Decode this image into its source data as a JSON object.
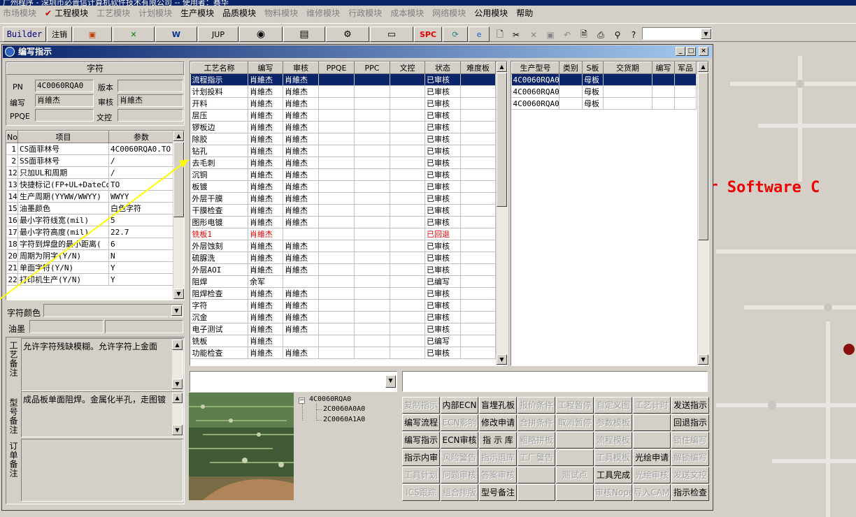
{
  "title_bar": "广州程序 - 深圳市必普信计算机软件技术有限公司 -- 使用者：赛华",
  "menu": [
    {
      "label": "市场模块",
      "enabled": false
    },
    {
      "label": "工程模块",
      "enabled": true,
      "checked": true
    },
    {
      "label": "工艺模块",
      "enabled": false
    },
    {
      "label": "计划模块",
      "enabled": false
    },
    {
      "label": "生产模块",
      "enabled": true
    },
    {
      "label": "品质模块",
      "enabled": true
    },
    {
      "label": "物料模块",
      "enabled": false
    },
    {
      "label": "维修模块",
      "enabled": false
    },
    {
      "label": "行政模块",
      "enabled": false
    },
    {
      "label": "成本模块",
      "enabled": false
    },
    {
      "label": "网络模块",
      "enabled": false
    },
    {
      "label": "公用模块",
      "enabled": true
    },
    {
      "label": "帮助",
      "enabled": true
    }
  ],
  "menu_check": "✔",
  "toolbar": {
    "builder": "Builder",
    "logout": "注销",
    "jup": "JUP",
    "spc": "SPC"
  },
  "background_text": "er Software C",
  "window": {
    "title": "编写指示",
    "min": "_",
    "max": "□",
    "close": "×"
  },
  "char_panel": {
    "header": "字符",
    "pn_label": "PN",
    "pn_value": "4C0060RQA0",
    "version_label": "版本",
    "version_value": "",
    "writer_label": "编写",
    "writer_value": "肖維杰",
    "reviewer_label": "审核",
    "reviewer_value": "肖維杰",
    "ppqe_label": "PPQE",
    "ppqe_value": "",
    "doc_label": "文控",
    "doc_value": ""
  },
  "param_table": {
    "columns": [
      "No",
      "项目",
      "参数"
    ],
    "rows": [
      [
        "1",
        "CS面菲林号",
        "4C0060RQA0.TO"
      ],
      [
        "2",
        "SS面菲林号",
        "/"
      ],
      [
        "12",
        "只加UL和周期",
        "/"
      ],
      [
        "13",
        "快捷标记(FP+UL+DateCo",
        "TO"
      ],
      [
        "14",
        "生产周期(YYWW/WWYY)",
        "WWYY"
      ],
      [
        "15",
        "油墨颜色",
        "白色字符"
      ],
      [
        "16",
        "最小字符线宽(mil)",
        "5"
      ],
      [
        "17",
        "最小字符高度(mil)",
        "22.7"
      ],
      [
        "18",
        "字符到焊盘的最小距离(",
        "6"
      ],
      [
        "20",
        "周期为阴字(Y/N)",
        "N"
      ],
      [
        "21",
        "单面字符(Y/N)",
        "Y"
      ],
      [
        "22",
        "打印机生产(Y/N)",
        "Y"
      ]
    ]
  },
  "char_color_label": "字符颜色",
  "ink_label": "油墨",
  "craft_note_label": "工艺备注",
  "craft_note": "允许字符残缺模糊。允许字符上金面",
  "model_note_label": "型号备注",
  "model_note": "成品板单面阻焊。金属化半孔，走图镀",
  "order_note_label": "订单备注",
  "order_note": "",
  "process_table": {
    "columns": [
      "工艺名称",
      "编写",
      "审核",
      "PPQE",
      "PPC",
      "文控",
      "状态",
      "难度板"
    ],
    "rows": [
      {
        "cells": [
          "流程指示",
          "肖維杰",
          "肖維杰",
          "",
          "",
          "",
          "已审核",
          ""
        ],
        "style": "sel"
      },
      {
        "cells": [
          "计划投料",
          "肖維杰",
          "肖維杰",
          "",
          "",
          "",
          "已审核",
          ""
        ],
        "style": ""
      },
      {
        "cells": [
          "开料",
          "肖維杰",
          "肖維杰",
          "",
          "",
          "",
          "已审核",
          ""
        ],
        "style": ""
      },
      {
        "cells": [
          "层压",
          "肖維杰",
          "肖維杰",
          "",
          "",
          "",
          "已审核",
          ""
        ],
        "style": ""
      },
      {
        "cells": [
          "锣板边",
          "肖維杰",
          "肖維杰",
          "",
          "",
          "",
          "已审核",
          ""
        ],
        "style": ""
      },
      {
        "cells": [
          "除胶",
          "肖維杰",
          "肖維杰",
          "",
          "",
          "",
          "已审核",
          ""
        ],
        "style": ""
      },
      {
        "cells": [
          "钻孔",
          "肖維杰",
          "肖維杰",
          "",
          "",
          "",
          "已审核",
          ""
        ],
        "style": ""
      },
      {
        "cells": [
          "去毛刺",
          "肖維杰",
          "肖維杰",
          "",
          "",
          "",
          "已审核",
          ""
        ],
        "style": ""
      },
      {
        "cells": [
          "沉铜",
          "肖維杰",
          "肖維杰",
          "",
          "",
          "",
          "已审核",
          ""
        ],
        "style": ""
      },
      {
        "cells": [
          "板镀",
          "肖維杰",
          "肖維杰",
          "",
          "",
          "",
          "已审核",
          ""
        ],
        "style": ""
      },
      {
        "cells": [
          "外层干膜",
          "肖維杰",
          "肖維杰",
          "",
          "",
          "",
          "已审核",
          ""
        ],
        "style": ""
      },
      {
        "cells": [
          "干膜检查",
          "肖維杰",
          "肖維杰",
          "",
          "",
          "",
          "已审核",
          ""
        ],
        "style": ""
      },
      {
        "cells": [
          "图形电镀",
          "肖維杰",
          "肖維杰",
          "",
          "",
          "",
          "已审核",
          ""
        ],
        "style": ""
      },
      {
        "cells": [
          "铣板1",
          "肖維杰",
          "",
          "",
          "",
          "",
          "已回退",
          ""
        ],
        "style": "red"
      },
      {
        "cells": [
          "外层蚀刻",
          "肖維杰",
          "肖維杰",
          "",
          "",
          "",
          "已审核",
          ""
        ],
        "style": ""
      },
      {
        "cells": [
          "硫脲洗",
          "肖維杰",
          "肖維杰",
          "",
          "",
          "",
          "已审核",
          ""
        ],
        "style": ""
      },
      {
        "cells": [
          "外层AOI",
          "肖維杰",
          "肖維杰",
          "",
          "",
          "",
          "已审核",
          ""
        ],
        "style": ""
      },
      {
        "cells": [
          "阻焊",
          "余军",
          "",
          "",
          "",
          "",
          "已编写",
          ""
        ],
        "style": ""
      },
      {
        "cells": [
          "阻焊检查",
          "肖維杰",
          "肖維杰",
          "",
          "",
          "",
          "已审核",
          ""
        ],
        "style": ""
      },
      {
        "cells": [
          "字符",
          "肖維杰",
          "肖維杰",
          "",
          "",
          "",
          "已审核",
          ""
        ],
        "style": ""
      },
      {
        "cells": [
          "沉金",
          "肖維杰",
          "肖維杰",
          "",
          "",
          "",
          "已审核",
          ""
        ],
        "style": ""
      },
      {
        "cells": [
          "电子测试",
          "肖維杰",
          "肖維杰",
          "",
          "",
          "",
          "已审核",
          ""
        ],
        "style": ""
      },
      {
        "cells": [
          "铣板",
          "肖維杰",
          "",
          "",
          "",
          "",
          "已编写",
          ""
        ],
        "style": ""
      },
      {
        "cells": [
          "功能检查",
          "肖維杰",
          "肖維杰",
          "",
          "",
          "",
          "已审核",
          ""
        ],
        "style": ""
      }
    ]
  },
  "model_table": {
    "columns": [
      "生产型号",
      "类别",
      "S板",
      "交货期",
      "编写",
      "军品"
    ],
    "rows": [
      {
        "cells": [
          "4C0060RQA0",
          "",
          "母板",
          "",
          "",
          ""
        ],
        "style": "sel"
      },
      {
        "cells": [
          "4C0060RQA0",
          "",
          "母板",
          "",
          "",
          ""
        ],
        "style": ""
      },
      {
        "cells": [
          "4C0060RQA0",
          "",
          "母板",
          "",
          "",
          ""
        ],
        "style": ""
      }
    ]
  },
  "tree": {
    "root": "4C0060RQA0",
    "children": [
      "2C0060A0A0",
      "2C0060A1A0"
    ],
    "toggle": "−"
  },
  "action_buttons": [
    [
      {
        "label": "复制指示",
        "enabled": false
      },
      {
        "label": "内部ECN",
        "enabled": true
      },
      {
        "label": "盲埋孔板",
        "enabled": true
      },
      {
        "label": "报价条件",
        "enabled": false
      },
      {
        "label": "工程暂停",
        "enabled": false
      },
      {
        "label": "自定义图",
        "enabled": false
      },
      {
        "label": "工艺计时",
        "enabled": false
      },
      {
        "label": "发送指示",
        "enabled": true
      }
    ],
    [
      {
        "label": "编写流程",
        "enabled": true
      },
      {
        "label": "ECN影响",
        "enabled": false
      },
      {
        "label": "修改申请",
        "enabled": true
      },
      {
        "label": "合拼条件",
        "enabled": false
      },
      {
        "label": "取消暂停",
        "enabled": false
      },
      {
        "label": "参数模板",
        "enabled": false
      },
      {
        "label": "",
        "enabled": false
      },
      {
        "label": "回退指示",
        "enabled": true
      }
    ],
    [
      {
        "label": "编写指示",
        "enabled": true
      },
      {
        "label": "ECN审核",
        "enabled": true
      },
      {
        "label": "指 示 库",
        "enabled": true
      },
      {
        "label": "粗略拼板",
        "enabled": false
      },
      {
        "label": "",
        "enabled": false
      },
      {
        "label": "流程模板",
        "enabled": false
      },
      {
        "label": "",
        "enabled": false
      },
      {
        "label": "锁住编写",
        "enabled": false
      }
    ],
    [
      {
        "label": "指示内审",
        "enabled": true
      },
      {
        "label": "风险警告",
        "enabled": false
      },
      {
        "label": "指示退库",
        "enabled": false
      },
      {
        "label": "工厂警告",
        "enabled": false
      },
      {
        "label": "",
        "enabled": false
      },
      {
        "label": "工具模板",
        "enabled": false
      },
      {
        "label": "光绘申请",
        "enabled": true
      },
      {
        "label": "解锁编写",
        "enabled": false
      }
    ],
    [
      {
        "label": "工具计划",
        "enabled": false
      },
      {
        "label": "问题审核",
        "enabled": false
      },
      {
        "label": "答案审核",
        "enabled": false
      },
      {
        "label": "",
        "enabled": false
      },
      {
        "label": "测试点",
        "enabled": false
      },
      {
        "label": "工具完成",
        "enabled": true
      },
      {
        "label": "光绘审核",
        "enabled": false
      },
      {
        "label": "发送文控",
        "enabled": false
      }
    ],
    [
      {
        "label": "ICS跟踪",
        "enabled": false
      },
      {
        "label": "组合排版",
        "enabled": false
      },
      {
        "label": "型号备注",
        "enabled": true
      },
      {
        "label": "",
        "enabled": false
      },
      {
        "label": "",
        "enabled": false
      },
      {
        "label": "审核Nope",
        "enabled": false
      },
      {
        "label": "导入CAM",
        "enabled": false
      },
      {
        "label": "指示检查",
        "enabled": true
      }
    ]
  ],
  "arrow_color": "#ffff00"
}
